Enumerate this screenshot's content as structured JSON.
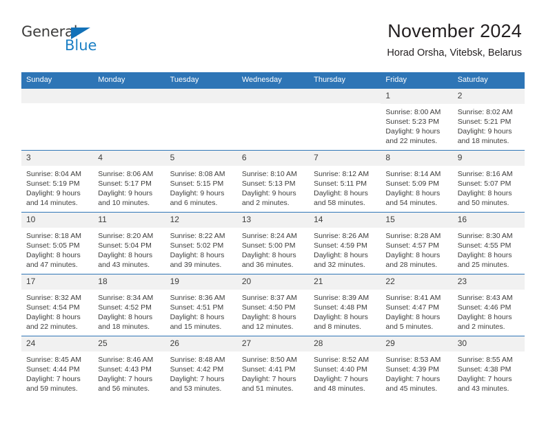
{
  "brand": {
    "name_top": "General",
    "name_bottom": "Blue",
    "triangle_color": "#1271b8",
    "text_color": "#3c3c3b",
    "blue_color": "#1b7fc4"
  },
  "header": {
    "title": "November 2024",
    "subtitle": "Horad Orsha, Vitebsk, Belarus"
  },
  "theme": {
    "header_bg": "#2e75b6",
    "header_text": "#ffffff",
    "daynum_bg": "#f1f1f1",
    "body_text": "#3c3c3b"
  },
  "weekdays": [
    "Sunday",
    "Monday",
    "Tuesday",
    "Wednesday",
    "Thursday",
    "Friday",
    "Saturday"
  ],
  "weeks": [
    [
      {
        "day": "",
        "empty": true,
        "sunrise": "",
        "sunset": "",
        "daylight1": "",
        "daylight2": ""
      },
      {
        "day": "",
        "empty": true,
        "sunrise": "",
        "sunset": "",
        "daylight1": "",
        "daylight2": ""
      },
      {
        "day": "",
        "empty": true,
        "sunrise": "",
        "sunset": "",
        "daylight1": "",
        "daylight2": ""
      },
      {
        "day": "",
        "empty": true,
        "sunrise": "",
        "sunset": "",
        "daylight1": "",
        "daylight2": ""
      },
      {
        "day": "",
        "empty": true,
        "sunrise": "",
        "sunset": "",
        "daylight1": "",
        "daylight2": ""
      },
      {
        "day": "1",
        "empty": false,
        "sunrise": "Sunrise: 8:00 AM",
        "sunset": "Sunset: 5:23 PM",
        "daylight1": "Daylight: 9 hours",
        "daylight2": "and 22 minutes."
      },
      {
        "day": "2",
        "empty": false,
        "sunrise": "Sunrise: 8:02 AM",
        "sunset": "Sunset: 5:21 PM",
        "daylight1": "Daylight: 9 hours",
        "daylight2": "and 18 minutes."
      }
    ],
    [
      {
        "day": "3",
        "empty": false,
        "sunrise": "Sunrise: 8:04 AM",
        "sunset": "Sunset: 5:19 PM",
        "daylight1": "Daylight: 9 hours",
        "daylight2": "and 14 minutes."
      },
      {
        "day": "4",
        "empty": false,
        "sunrise": "Sunrise: 8:06 AM",
        "sunset": "Sunset: 5:17 PM",
        "daylight1": "Daylight: 9 hours",
        "daylight2": "and 10 minutes."
      },
      {
        "day": "5",
        "empty": false,
        "sunrise": "Sunrise: 8:08 AM",
        "sunset": "Sunset: 5:15 PM",
        "daylight1": "Daylight: 9 hours",
        "daylight2": "and 6 minutes."
      },
      {
        "day": "6",
        "empty": false,
        "sunrise": "Sunrise: 8:10 AM",
        "sunset": "Sunset: 5:13 PM",
        "daylight1": "Daylight: 9 hours",
        "daylight2": "and 2 minutes."
      },
      {
        "day": "7",
        "empty": false,
        "sunrise": "Sunrise: 8:12 AM",
        "sunset": "Sunset: 5:11 PM",
        "daylight1": "Daylight: 8 hours",
        "daylight2": "and 58 minutes."
      },
      {
        "day": "8",
        "empty": false,
        "sunrise": "Sunrise: 8:14 AM",
        "sunset": "Sunset: 5:09 PM",
        "daylight1": "Daylight: 8 hours",
        "daylight2": "and 54 minutes."
      },
      {
        "day": "9",
        "empty": false,
        "sunrise": "Sunrise: 8:16 AM",
        "sunset": "Sunset: 5:07 PM",
        "daylight1": "Daylight: 8 hours",
        "daylight2": "and 50 minutes."
      }
    ],
    [
      {
        "day": "10",
        "empty": false,
        "sunrise": "Sunrise: 8:18 AM",
        "sunset": "Sunset: 5:05 PM",
        "daylight1": "Daylight: 8 hours",
        "daylight2": "and 47 minutes."
      },
      {
        "day": "11",
        "empty": false,
        "sunrise": "Sunrise: 8:20 AM",
        "sunset": "Sunset: 5:04 PM",
        "daylight1": "Daylight: 8 hours",
        "daylight2": "and 43 minutes."
      },
      {
        "day": "12",
        "empty": false,
        "sunrise": "Sunrise: 8:22 AM",
        "sunset": "Sunset: 5:02 PM",
        "daylight1": "Daylight: 8 hours",
        "daylight2": "and 39 minutes."
      },
      {
        "day": "13",
        "empty": false,
        "sunrise": "Sunrise: 8:24 AM",
        "sunset": "Sunset: 5:00 PM",
        "daylight1": "Daylight: 8 hours",
        "daylight2": "and 36 minutes."
      },
      {
        "day": "14",
        "empty": false,
        "sunrise": "Sunrise: 8:26 AM",
        "sunset": "Sunset: 4:59 PM",
        "daylight1": "Daylight: 8 hours",
        "daylight2": "and 32 minutes."
      },
      {
        "day": "15",
        "empty": false,
        "sunrise": "Sunrise: 8:28 AM",
        "sunset": "Sunset: 4:57 PM",
        "daylight1": "Daylight: 8 hours",
        "daylight2": "and 28 minutes."
      },
      {
        "day": "16",
        "empty": false,
        "sunrise": "Sunrise: 8:30 AM",
        "sunset": "Sunset: 4:55 PM",
        "daylight1": "Daylight: 8 hours",
        "daylight2": "and 25 minutes."
      }
    ],
    [
      {
        "day": "17",
        "empty": false,
        "sunrise": "Sunrise: 8:32 AM",
        "sunset": "Sunset: 4:54 PM",
        "daylight1": "Daylight: 8 hours",
        "daylight2": "and 22 minutes."
      },
      {
        "day": "18",
        "empty": false,
        "sunrise": "Sunrise: 8:34 AM",
        "sunset": "Sunset: 4:52 PM",
        "daylight1": "Daylight: 8 hours",
        "daylight2": "and 18 minutes."
      },
      {
        "day": "19",
        "empty": false,
        "sunrise": "Sunrise: 8:36 AM",
        "sunset": "Sunset: 4:51 PM",
        "daylight1": "Daylight: 8 hours",
        "daylight2": "and 15 minutes."
      },
      {
        "day": "20",
        "empty": false,
        "sunrise": "Sunrise: 8:37 AM",
        "sunset": "Sunset: 4:50 PM",
        "daylight1": "Daylight: 8 hours",
        "daylight2": "and 12 minutes."
      },
      {
        "day": "21",
        "empty": false,
        "sunrise": "Sunrise: 8:39 AM",
        "sunset": "Sunset: 4:48 PM",
        "daylight1": "Daylight: 8 hours",
        "daylight2": "and 8 minutes."
      },
      {
        "day": "22",
        "empty": false,
        "sunrise": "Sunrise: 8:41 AM",
        "sunset": "Sunset: 4:47 PM",
        "daylight1": "Daylight: 8 hours",
        "daylight2": "and 5 minutes."
      },
      {
        "day": "23",
        "empty": false,
        "sunrise": "Sunrise: 8:43 AM",
        "sunset": "Sunset: 4:46 PM",
        "daylight1": "Daylight: 8 hours",
        "daylight2": "and 2 minutes."
      }
    ],
    [
      {
        "day": "24",
        "empty": false,
        "sunrise": "Sunrise: 8:45 AM",
        "sunset": "Sunset: 4:44 PM",
        "daylight1": "Daylight: 7 hours",
        "daylight2": "and 59 minutes."
      },
      {
        "day": "25",
        "empty": false,
        "sunrise": "Sunrise: 8:46 AM",
        "sunset": "Sunset: 4:43 PM",
        "daylight1": "Daylight: 7 hours",
        "daylight2": "and 56 minutes."
      },
      {
        "day": "26",
        "empty": false,
        "sunrise": "Sunrise: 8:48 AM",
        "sunset": "Sunset: 4:42 PM",
        "daylight1": "Daylight: 7 hours",
        "daylight2": "and 53 minutes."
      },
      {
        "day": "27",
        "empty": false,
        "sunrise": "Sunrise: 8:50 AM",
        "sunset": "Sunset: 4:41 PM",
        "daylight1": "Daylight: 7 hours",
        "daylight2": "and 51 minutes."
      },
      {
        "day": "28",
        "empty": false,
        "sunrise": "Sunrise: 8:52 AM",
        "sunset": "Sunset: 4:40 PM",
        "daylight1": "Daylight: 7 hours",
        "daylight2": "and 48 minutes."
      },
      {
        "day": "29",
        "empty": false,
        "sunrise": "Sunrise: 8:53 AM",
        "sunset": "Sunset: 4:39 PM",
        "daylight1": "Daylight: 7 hours",
        "daylight2": "and 45 minutes."
      },
      {
        "day": "30",
        "empty": false,
        "sunrise": "Sunrise: 8:55 AM",
        "sunset": "Sunset: 4:38 PM",
        "daylight1": "Daylight: 7 hours",
        "daylight2": "and 43 minutes."
      }
    ]
  ]
}
